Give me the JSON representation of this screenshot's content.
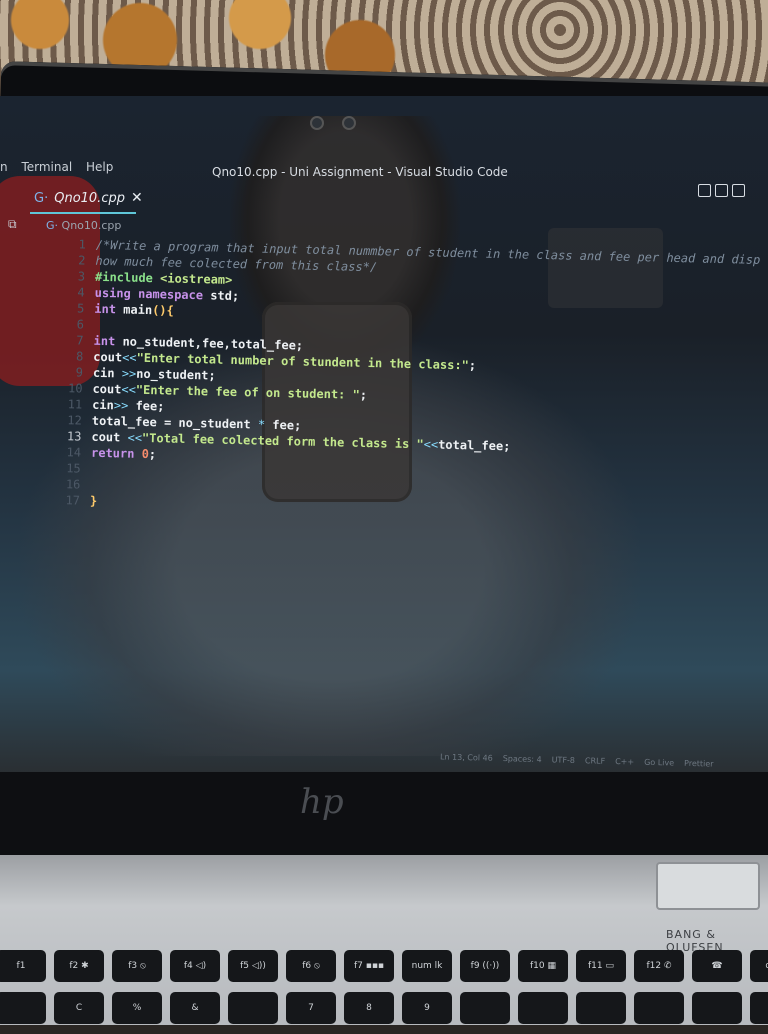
{
  "window": {
    "title": "Qno10.cpp - Uni Assignment - Visual Studio Code",
    "menu": [
      "n",
      "Terminal",
      "Help"
    ]
  },
  "editor": {
    "tab_label": "Qno10.cpp",
    "tab_close": "✕",
    "breadcrumb": "Qno10.cpp",
    "active_line": 13,
    "lines": [
      {
        "n": "1",
        "parts": [
          [
            "comment",
            "/*Write a program that input total nummber of student in the class and fee per head and disp"
          ]
        ]
      },
      {
        "n": "2",
        "parts": [
          [
            "comment",
            "how much fee colected from this class*/"
          ]
        ]
      },
      {
        "n": "3",
        "parts": [
          [
            "pre",
            "#include "
          ],
          [
            "str",
            "<iostream>"
          ]
        ]
      },
      {
        "n": "4",
        "parts": [
          [
            "kw",
            "using namespace "
          ],
          [
            "txt",
            "std;"
          ]
        ]
      },
      {
        "n": "5",
        "parts": [
          [
            "kw",
            "int "
          ],
          [
            "txt",
            "main"
          ],
          [
            "brace",
            "(){"
          ]
        ]
      },
      {
        "n": "6",
        "parts": []
      },
      {
        "n": "7",
        "parts": [
          [
            "kw",
            "int "
          ],
          [
            "txt",
            "no_student,fee,total_fee;"
          ]
        ]
      },
      {
        "n": "8",
        "parts": [
          [
            "txt",
            "cout"
          ],
          [
            "op",
            "<<"
          ],
          [
            "str",
            "\"Enter total number of stundent in the class:\""
          ],
          [
            "txt",
            ";"
          ]
        ]
      },
      {
        "n": "9",
        "parts": [
          [
            "txt",
            "cin "
          ],
          [
            "op",
            ">>"
          ],
          [
            "txt",
            "no_student;"
          ]
        ]
      },
      {
        "n": "10",
        "parts": [
          [
            "txt",
            "cout"
          ],
          [
            "op",
            "<<"
          ],
          [
            "str",
            "\"Enter the fee of on student: \""
          ],
          [
            "txt",
            ";"
          ]
        ]
      },
      {
        "n": "11",
        "parts": [
          [
            "txt",
            "cin"
          ],
          [
            "op",
            ">> "
          ],
          [
            "txt",
            "fee;"
          ]
        ]
      },
      {
        "n": "12",
        "parts": [
          [
            "txt",
            "total_fee = no_student "
          ],
          [
            "op",
            "* "
          ],
          [
            "txt",
            "fee;"
          ]
        ]
      },
      {
        "n": "13",
        "parts": [
          [
            "txt",
            "cout "
          ],
          [
            "op",
            "<<"
          ],
          [
            "str",
            "\"Total fee colected form the class is \""
          ],
          [
            "op",
            "<<"
          ],
          [
            "txt",
            "total_fee;"
          ]
        ]
      },
      {
        "n": "14",
        "parts": [
          [
            "kw",
            "return "
          ],
          [
            "num",
            "0"
          ],
          [
            "txt",
            ";"
          ]
        ]
      },
      {
        "n": "15",
        "parts": []
      },
      {
        "n": "16",
        "parts": []
      },
      {
        "n": "17",
        "parts": [
          [
            "brace",
            "}"
          ]
        ]
      }
    ]
  },
  "status": [
    "Ln 13, Col 46",
    "Spaces: 4",
    "UTF-8",
    "CRLF",
    "C++",
    "Go Live",
    "Prettier"
  ],
  "laptop": {
    "logo": "hp",
    "brand": "BANG & OLUFSEN",
    "keys_row1": [
      "f1",
      "f2 ✱",
      "f3 ⦸",
      "f4 ◁)",
      "f5 ◁))",
      "f6 ⦸",
      "f7 ▪▪▪",
      "num lk",
      "f9 ((·))",
      "f10 ▦",
      "f11 ▭",
      "f12 ✆",
      "☎",
      "dele"
    ],
    "keys_row2": [
      "",
      "C",
      "%",
      "&",
      "",
      "7",
      "8",
      "9",
      "",
      "",
      "",
      "",
      "",
      ""
    ]
  }
}
